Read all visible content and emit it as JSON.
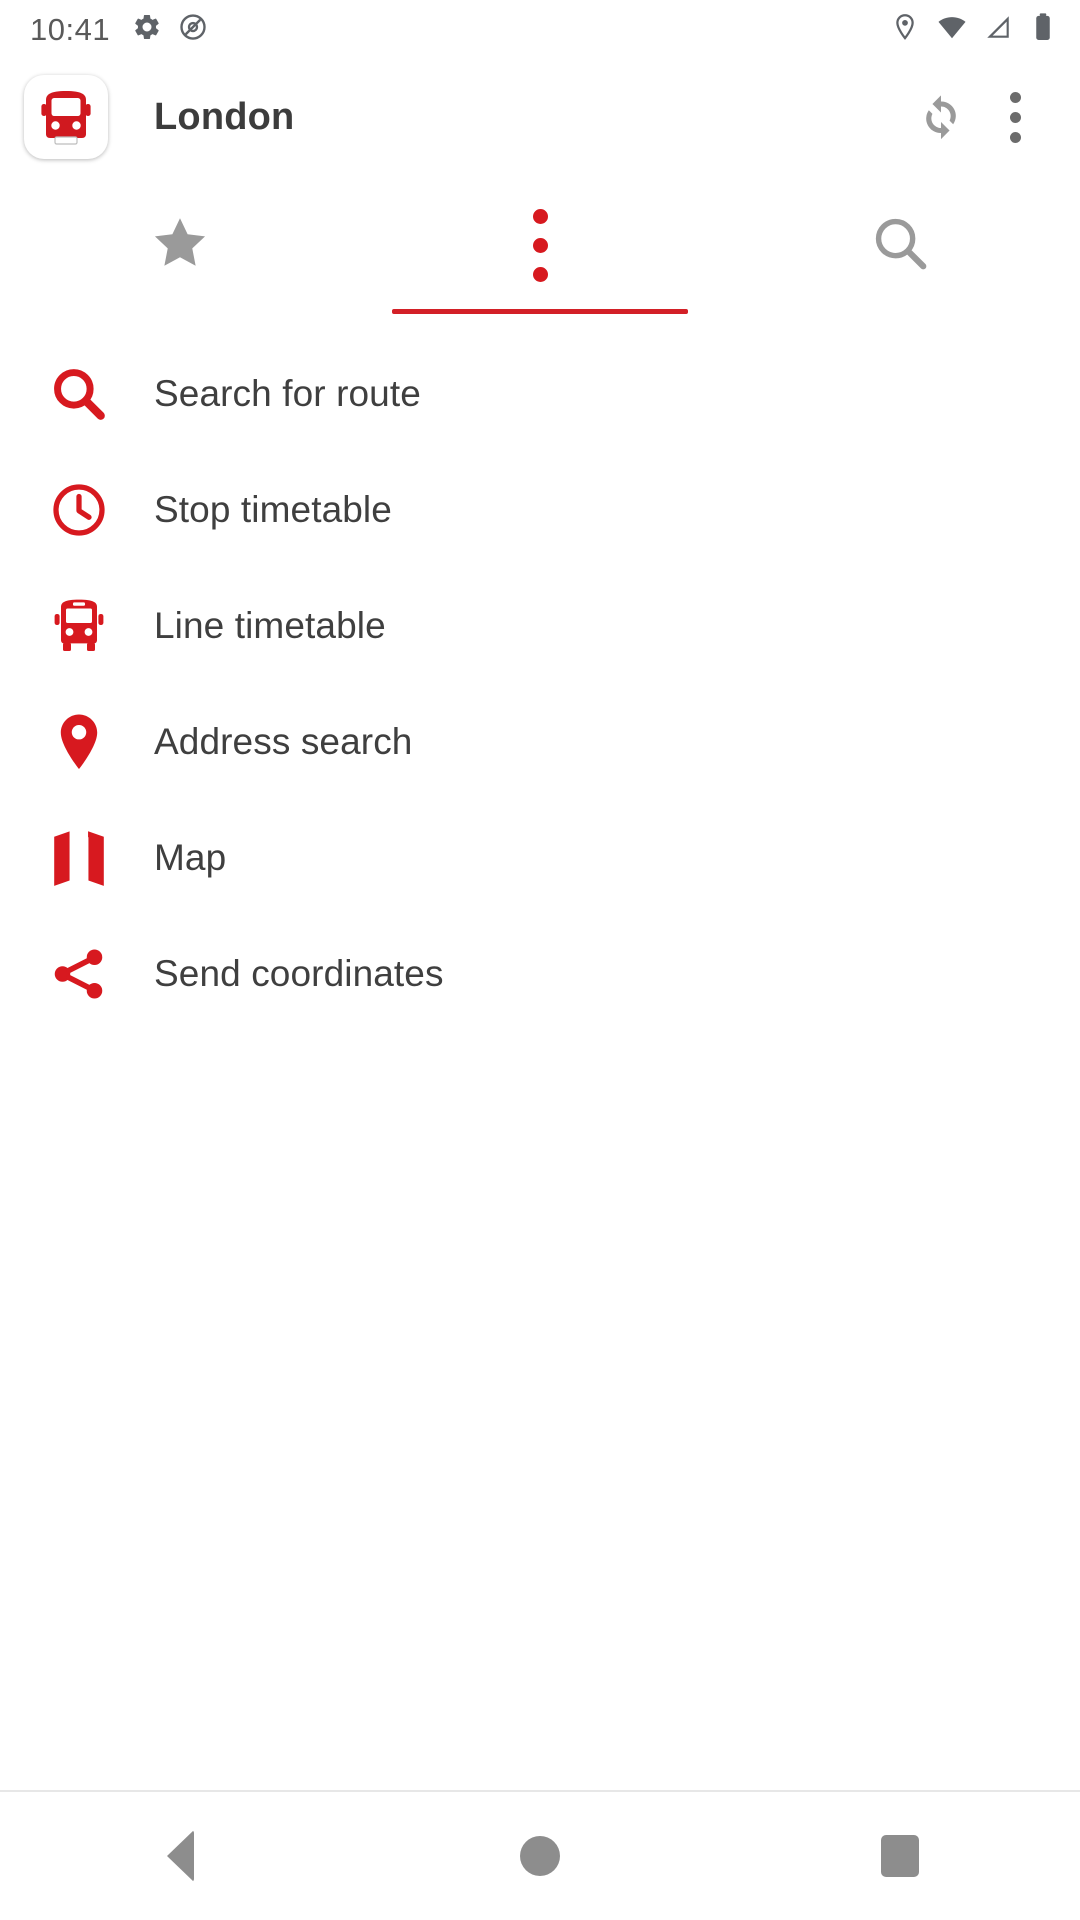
{
  "status_bar": {
    "time": "10:41",
    "left_icons": [
      "gear-icon",
      "do-not-disturb-icon"
    ],
    "right_icons": [
      "location-pin-icon",
      "wifi-icon",
      "cellular-signal-icon",
      "battery-icon"
    ]
  },
  "app_bar": {
    "logo_icon": "bus-app-logo",
    "title": "London",
    "actions": [
      {
        "name": "refresh-button",
        "icon": "refresh-icon"
      },
      {
        "name": "overflow-menu-button",
        "icon": "more-vert-icon"
      }
    ]
  },
  "tabs": {
    "items": [
      {
        "name": "tab-favorites",
        "icon": "star-icon",
        "selected": false
      },
      {
        "name": "tab-more",
        "icon": "more-vert-icon",
        "selected": true
      },
      {
        "name": "tab-search",
        "icon": "search-icon",
        "selected": false
      }
    ],
    "indicator_color": "#d32027"
  },
  "menu": {
    "items": [
      {
        "label": "Search for route",
        "icon": "search-icon"
      },
      {
        "label": "Stop timetable",
        "icon": "clock-icon"
      },
      {
        "label": "Line timetable",
        "icon": "bus-icon"
      },
      {
        "label": "Address search",
        "icon": "map-pin-icon"
      },
      {
        "label": "Map",
        "icon": "map-icon"
      },
      {
        "label": "Send coordinates",
        "icon": "share-icon"
      }
    ]
  },
  "system_nav": {
    "back": "back-button",
    "home": "home-button",
    "recents": "recents-button"
  },
  "colors": {
    "accent_red": "#d7191f",
    "text_primary": "#3f3f3f",
    "icon_gray": "#8d8d8d"
  }
}
